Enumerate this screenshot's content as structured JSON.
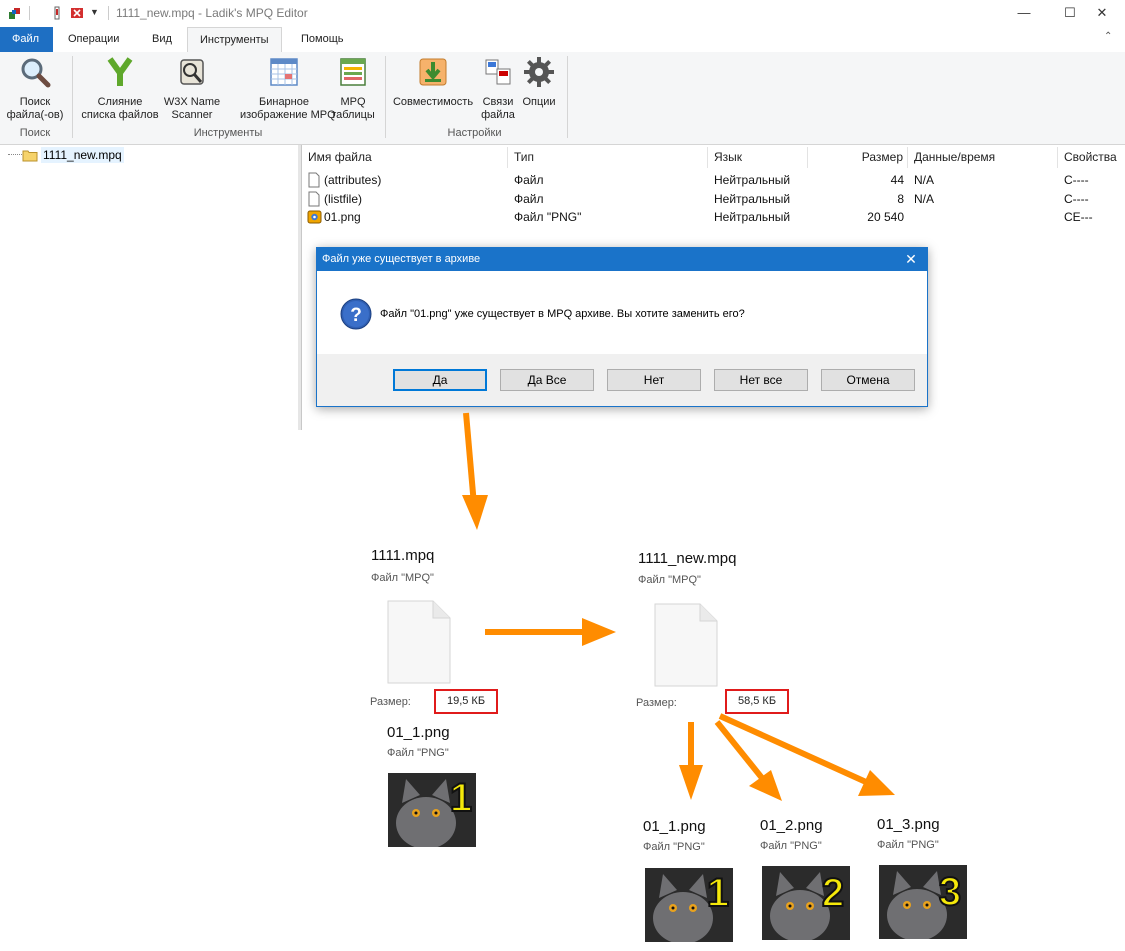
{
  "window": {
    "title": "1111_new.mpq - Ladik's MPQ Editor",
    "minimize": "—",
    "maximize": "☐",
    "close": "✕"
  },
  "ribbon": {
    "tabs": [
      "Файл",
      "Операции",
      "Вид",
      "Инструменты",
      "Помощь"
    ],
    "active_tab": "Инструменты",
    "buttons": {
      "search": "Поиск\nфайла(-ов)",
      "merge": "Слияние\nсписка файлов",
      "w3x": "W3X Name\nScanner",
      "binary": "Бинарное\nизображение MPQ",
      "tables": "MPQ\nтаблицы",
      "compat": "Совместимость",
      "assoc": "Связи\nфайла",
      "options": "Опции"
    },
    "groups": {
      "search": "Поиск",
      "tools": "Инструменты",
      "settings": "Настройки"
    }
  },
  "tree": {
    "root": "1111_new.mpq"
  },
  "file_list": {
    "headers": [
      "Имя файла",
      "Тип",
      "Язык",
      "Размер",
      "Данные/время",
      "Свойства"
    ],
    "rows": [
      {
        "name": "(attributes)",
        "type": "Файл",
        "lang": "Нейтральный",
        "size": "44",
        "date": "N/A",
        "props": "C----"
      },
      {
        "name": "(listfile)",
        "type": "Файл",
        "lang": "Нейтральный",
        "size": "8",
        "date": "N/A",
        "props": "C----"
      },
      {
        "name": "01.png",
        "type": "Файл \"PNG\"",
        "lang": "Нейтральный",
        "size": "20 540",
        "date": "",
        "props": "CE---"
      }
    ]
  },
  "dialog": {
    "title": "Файл уже существует в архиве",
    "message": "Файл \"01.png\" уже существует в MPQ архиве. Вы хотите заменить его?",
    "buttons": {
      "yes": "Да",
      "yes_all": "Да Все",
      "no": "Нет",
      "no_all": "Нет все",
      "cancel": "Отмена"
    }
  },
  "illustration": {
    "left": {
      "file_name": "1111.mpq",
      "file_type": "Файл \"MPQ\"",
      "size_label": "Размер:",
      "size_value": "19,5 КБ",
      "image_name": "01_1.png",
      "image_type": "Файл \"PNG\"",
      "badge": "1"
    },
    "right": {
      "file_name": "1111_new.mpq",
      "file_type": "Файл \"MPQ\"",
      "size_label": "Размер:",
      "size_value": "58,5 КБ",
      "images": [
        {
          "name": "01_1.png",
          "type": "Файл \"PNG\"",
          "badge": "1"
        },
        {
          "name": "01_2.png",
          "type": "Файл \"PNG\"",
          "badge": "2"
        },
        {
          "name": "01_3.png",
          "type": "Файл \"PNG\"",
          "badge": "3"
        }
      ]
    },
    "arrow_color": "#ff8c00",
    "highlight_color": "#e01b1b"
  }
}
